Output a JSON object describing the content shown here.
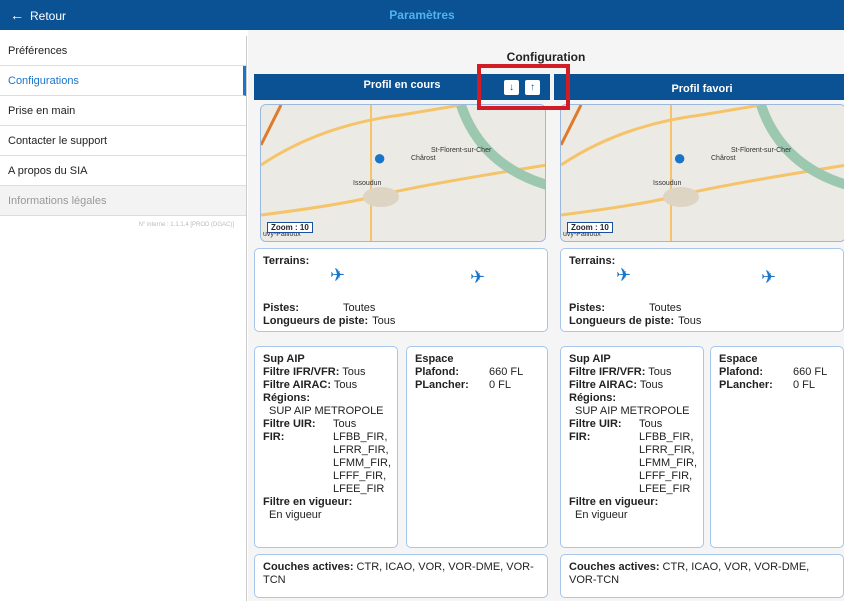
{
  "topbar": {
    "back_label": "Retour",
    "title": "Paramètres"
  },
  "sidebar": {
    "items": [
      {
        "label": "Préférences"
      },
      {
        "label": "Configurations"
      },
      {
        "label": "Prise en main"
      },
      {
        "label": "Contacter le support"
      },
      {
        "label": "A propos du SIA"
      },
      {
        "label": "Informations légales"
      }
    ],
    "version": "N° interne : 1.1.1.4 [PROD (DGAC)]"
  },
  "main": {
    "title": "Configuration",
    "columns": [
      {
        "header": "Profil en cours",
        "map": {
          "zoom": "Zoom : 10",
          "city1": "Issoudun",
          "city2": "Chârost",
          "city3": "St-Florent-sur-Cher",
          "city4": "uvy-Pailloux"
        },
        "terrains_label": "Terrains:",
        "pistes_label": "Pistes:",
        "pistes_value": "Toutes",
        "longueurs_label": "Longueurs de piste:",
        "longueurs_value": "Tous",
        "sup_aip_title": "Sup AIP",
        "filtre_ifr_label": "Filtre IFR/VFR:",
        "filtre_ifr_value": "Tous",
        "filtre_airac_label": "Filtre AIRAC:",
        "filtre_airac_value": "Tous",
        "regions_label": "Régions:",
        "regions_value": "SUP AIP METROPOLE",
        "filtre_uir_label": "Filtre UIR:",
        "filtre_uir_value": "Tous",
        "fir_label": "FIR:",
        "fir_values": [
          "LFBB_FIR,",
          "LFRR_FIR,",
          "LFMM_FIR,",
          "LFFF_FIR,",
          "LFEE_FIR"
        ],
        "filtre_vigueur_label": "Filtre en vigueur:",
        "filtre_vigueur_value": "En vigueur",
        "espace_title": "Espace",
        "plafond_label": "Plafond:",
        "plafond_value": "660 FL",
        "plancher_label": "PLancher:",
        "plancher_value": "0 FL",
        "couches_label": "Couches actives:",
        "couches_value": "CTR, ICAO, VOR, VOR-DME, VOR-TCN"
      },
      {
        "header": "Profil favori",
        "map": {
          "zoom": "Zoom : 10",
          "city1": "Issoudun",
          "city2": "Chârost",
          "city3": "St-Florent-sur-Cher",
          "city4": "uvy-Pailloux"
        },
        "terrains_label": "Terrains:",
        "pistes_label": "Pistes:",
        "pistes_value": "Toutes",
        "longueurs_label": "Longueurs de piste:",
        "longueurs_value": "Tous",
        "sup_aip_title": "Sup AIP",
        "filtre_ifr_label": "Filtre IFR/VFR:",
        "filtre_ifr_value": "Tous",
        "filtre_airac_label": "Filtre AIRAC:",
        "filtre_airac_value": "Tous",
        "regions_label": "Régions:",
        "regions_value": "SUP AIP METROPOLE",
        "filtre_uir_label": "Filtre UIR:",
        "filtre_uir_value": "Tous",
        "fir_label": "FIR:",
        "fir_values": [
          "LFBB_FIR,",
          "LFRR_FIR,",
          "LFMM_FIR,",
          "LFFF_FIR,",
          "LFEE_FIR"
        ],
        "filtre_vigueur_label": "Filtre en vigueur:",
        "filtre_vigueur_value": "En vigueur",
        "espace_title": "Espace",
        "plafond_label": "Plafond:",
        "plafond_value": "660 FL",
        "plancher_label": "PLancher:",
        "plancher_value": "0 FL",
        "couches_label": "Couches actives:",
        "couches_value": "CTR, ICAO, VOR, VOR-DME, VOR-TCN"
      }
    ]
  },
  "colors": {
    "brand": "#0a5294",
    "accent": "#1a75c9",
    "highlight": "#d11e26"
  },
  "icons": [
    "back-arrow-icon",
    "download-icon",
    "upload-icon",
    "map-pin-icon",
    "plane-icon",
    "helicopter-icon"
  ]
}
